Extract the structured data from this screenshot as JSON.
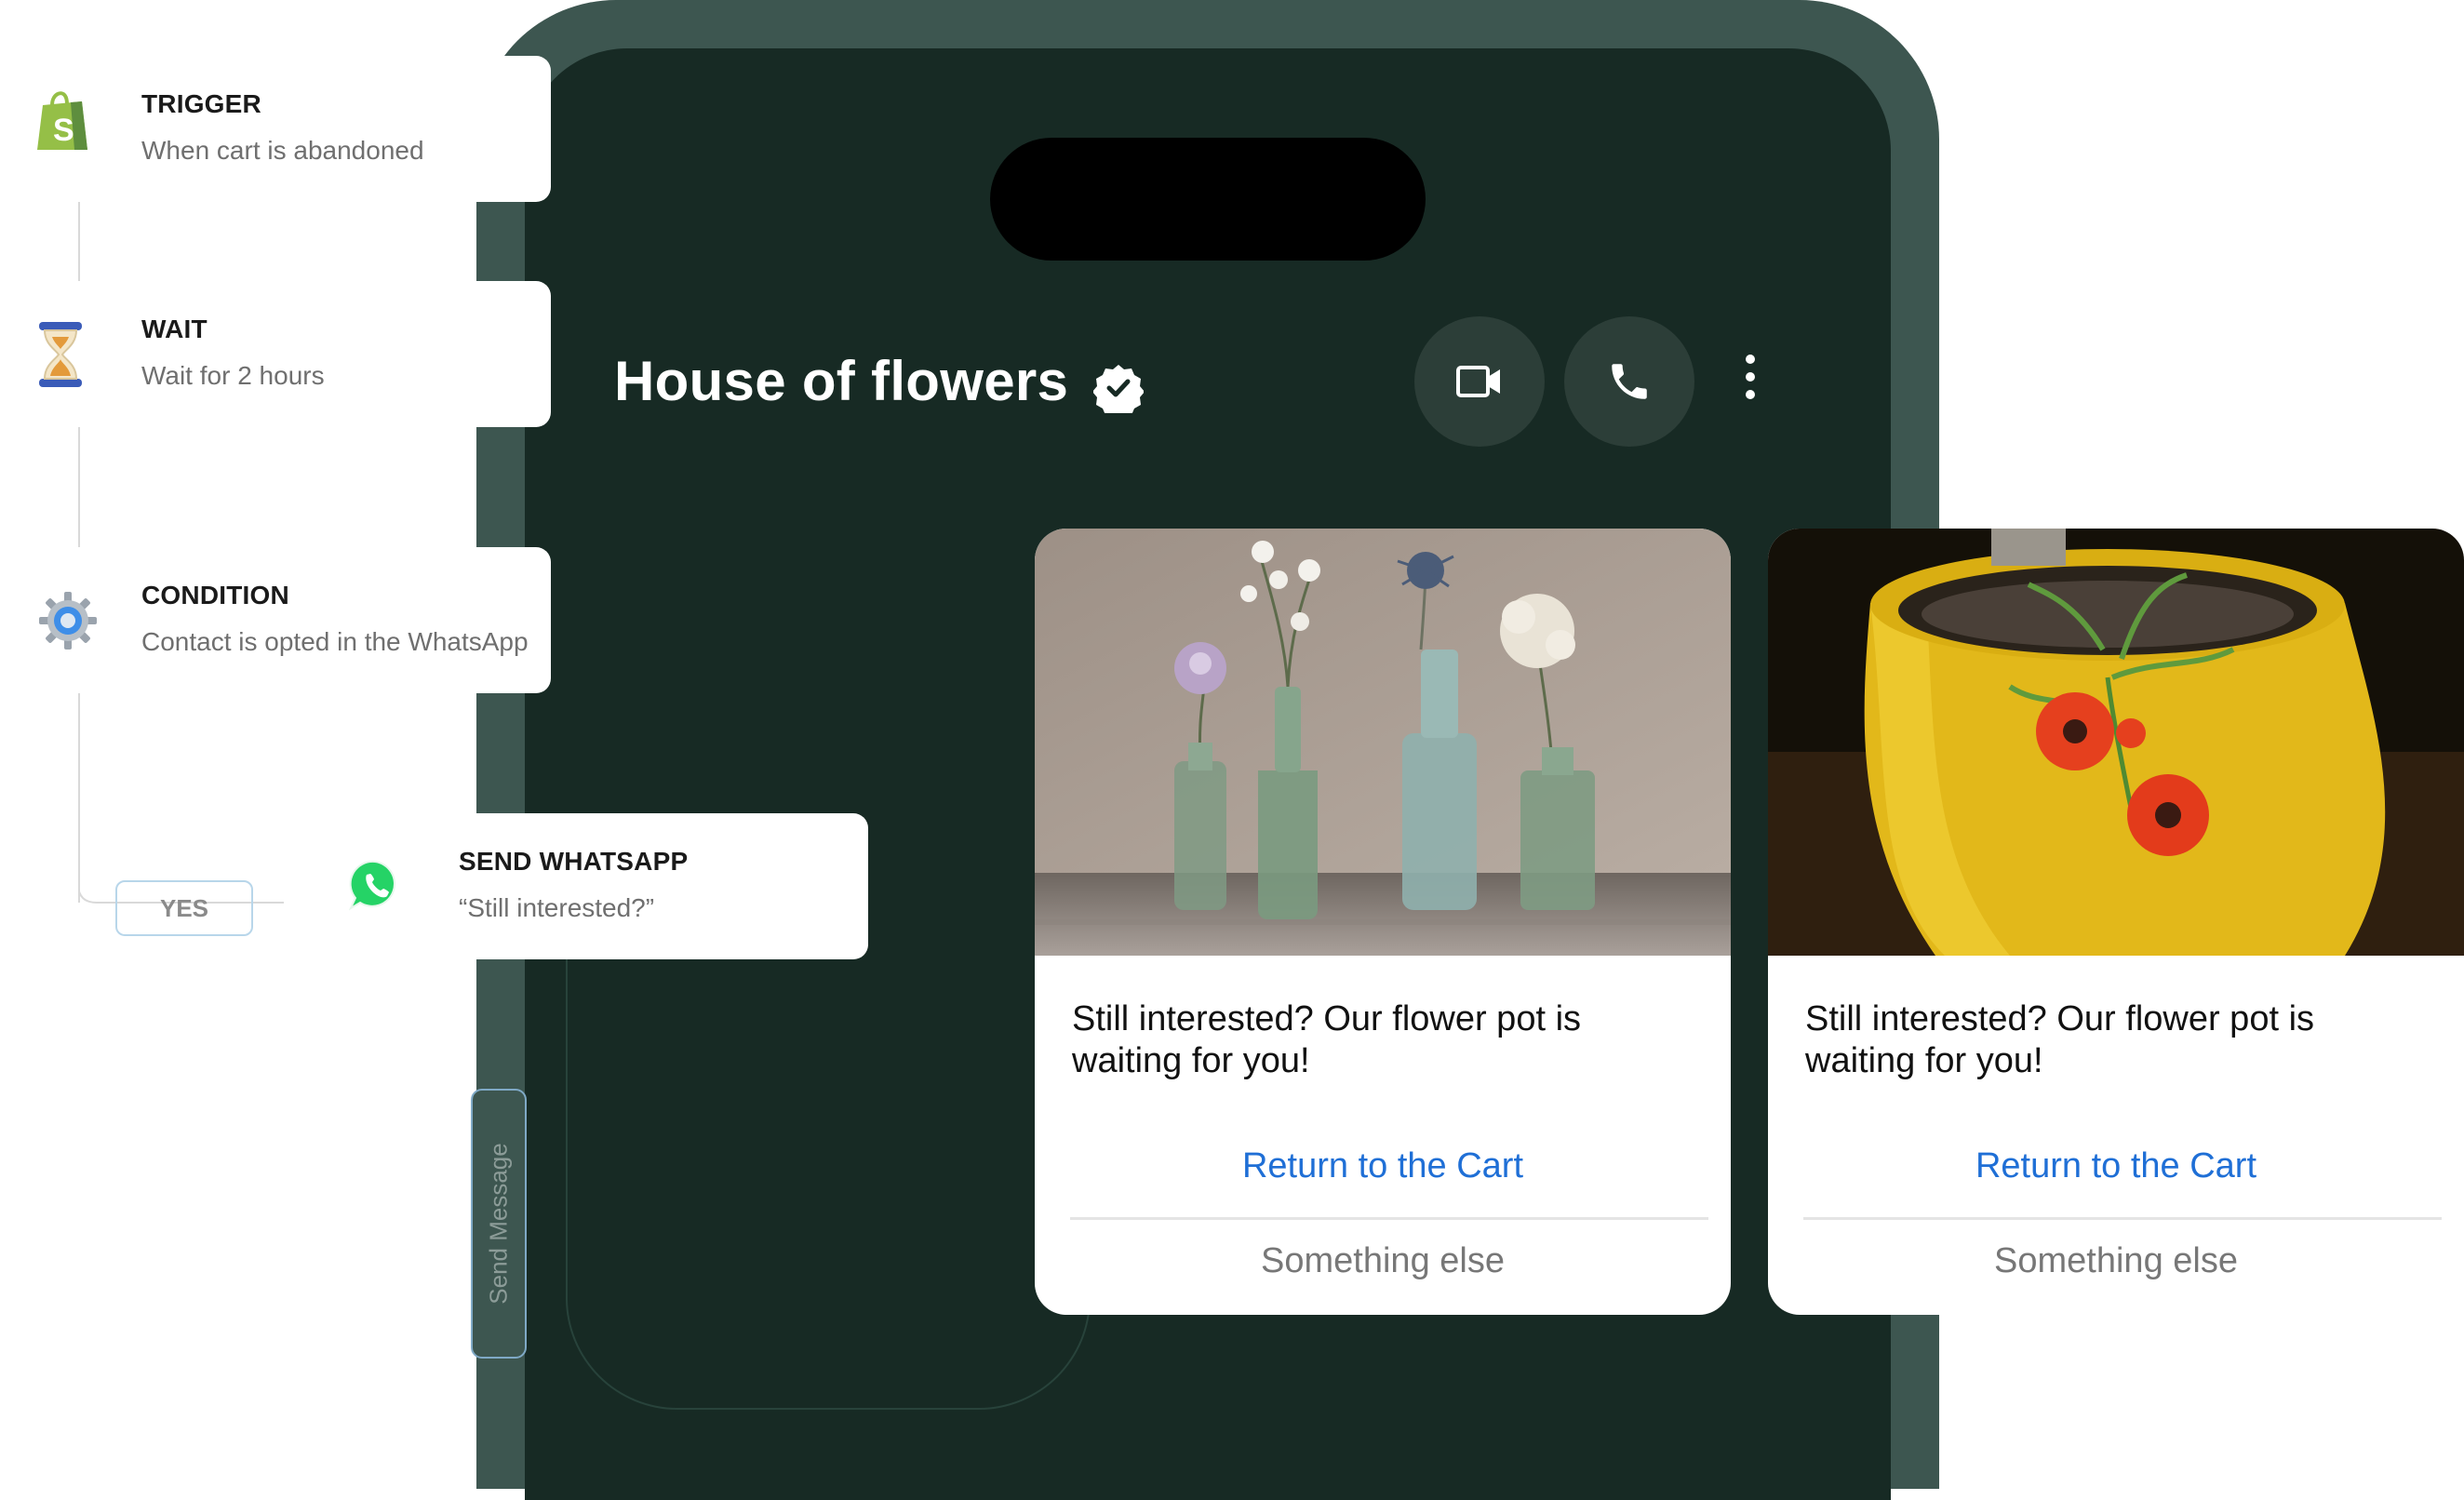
{
  "flow": {
    "trigger": {
      "title": "TRIGGER",
      "subtitle": "When cart is abandoned",
      "icon": "shopify-bag-icon"
    },
    "wait": {
      "title": "WAIT",
      "subtitle": "Wait for 2  hours",
      "icon": "hourglass-icon"
    },
    "condition": {
      "title": "CONDITION",
      "subtitle": "Contact is opted in the WhatsApp",
      "icon": "gear-icon"
    },
    "branch_label": "YES",
    "send": {
      "title": "SEND WHATSAPP",
      "subtitle": "“Still interested?”",
      "icon": "whatsapp-icon"
    },
    "send_tab_label": "Send Message"
  },
  "chat": {
    "title": "House of flowers",
    "verified": true
  },
  "cards": [
    {
      "image": "flowers-in-glass-bottles",
      "text": "Still interested? Our flower pot is waiting for you!",
      "primary_cta": "Return to the Cart",
      "secondary_cta": "Something else"
    },
    {
      "image": "yellow-pot-with-red-flowers",
      "text": "Still interested? Our flower pot is waiting for you!",
      "primary_cta": "Return to the Cart",
      "secondary_cta": "Something else"
    }
  ],
  "colors": {
    "phone_frame": "#3d5650",
    "phone_screen": "#172a24",
    "link": "#1f6fd6",
    "whatsapp": "#25d366",
    "shopify": "#95bf47"
  }
}
